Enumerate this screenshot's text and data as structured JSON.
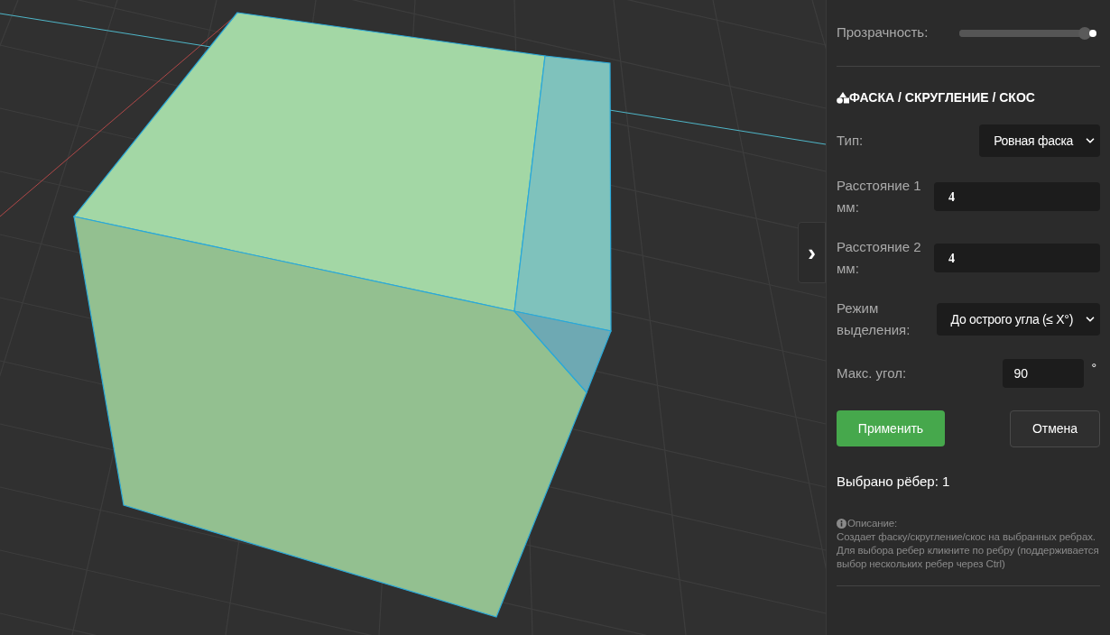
{
  "viewport": {
    "collapse_button": "›"
  },
  "panel": {
    "opacity": {
      "label": "Прозрачность:",
      "level": 0.95
    },
    "section_title": "ФАСКА / СКРУГЛЕНИЕ / СКОС",
    "fields": [
      {
        "kind": "select",
        "label": "Тип:",
        "value": "Ровная фаска"
      },
      {
        "kind": "input",
        "label": "Расстояние 1 мм:",
        "value": "4"
      },
      {
        "kind": "input",
        "label": "Расстояние 2 мм:",
        "value": "4"
      },
      {
        "kind": "select",
        "label": "Режим выделения:",
        "value": "До острого угла (≤ X°)"
      },
      {
        "kind": "angle",
        "label": "Макс. угол:",
        "value": "90",
        "unit": "°"
      }
    ],
    "buttons": [
      {
        "label": "Применить",
        "kind": "primary"
      },
      {
        "label": "Отмена",
        "kind": "secondary"
      }
    ],
    "selected_count": "Выбрано рёбер: 1",
    "description": {
      "title": "Описание:",
      "lines": [
        "Создает фаску/скругление/скос на выбранных ребрах.",
        "Для выбора ребер кликните по ребру (поддерживается выбор нескольких ребер через Ctrl)"
      ]
    }
  }
}
